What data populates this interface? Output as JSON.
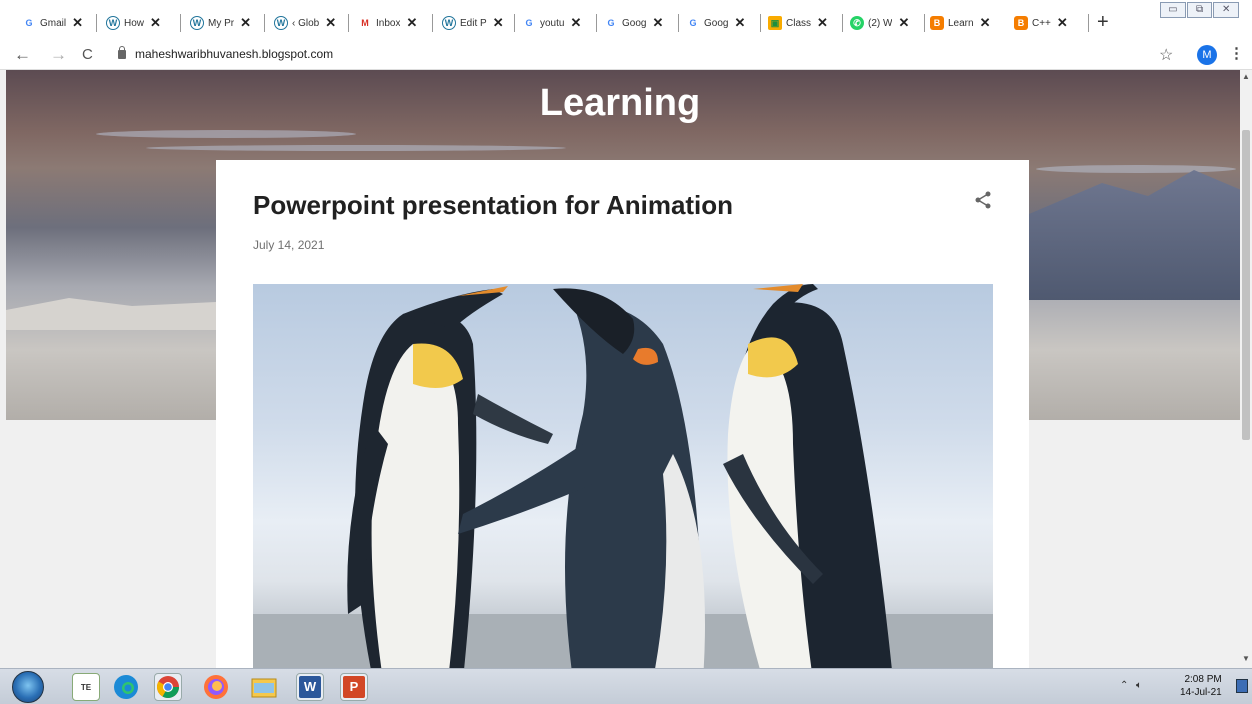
{
  "tabs": [
    {
      "title": "Gmail",
      "icon": "google-icon"
    },
    {
      "title": "How",
      "icon": "wordpress-icon"
    },
    {
      "title": "My Pr",
      "icon": "wordpress-icon"
    },
    {
      "title": "‹ Glob",
      "icon": "wordpress-icon"
    },
    {
      "title": "Inbox",
      "icon": "gmail-icon"
    },
    {
      "title": "Edit P",
      "icon": "wordpress-icon"
    },
    {
      "title": "youtu",
      "icon": "google-icon"
    },
    {
      "title": "Goog",
      "icon": "google-icon"
    },
    {
      "title": "Goog",
      "icon": "google-icon"
    },
    {
      "title": "Class",
      "icon": "classroom-icon"
    },
    {
      "title": "(2) W",
      "icon": "whatsapp-icon"
    },
    {
      "title": "Learn",
      "icon": "blogger-icon"
    },
    {
      "title": "C++",
      "icon": "blogger-icon"
    }
  ],
  "address_bar": {
    "url": "maheshwaribhuvanesh.blogspot.com",
    "profile_initial": "M"
  },
  "blog": {
    "title": "Learning"
  },
  "post": {
    "title": "Powerpoint presentation for Animation",
    "date": "July 14, 2021"
  },
  "taskbar": {
    "time": "2:08 PM",
    "date": "14-Jul-21",
    "apps": [
      "tally-icon",
      "edge-icon",
      "chrome-icon",
      "firefox-icon",
      "file-explorer-icon",
      "word-icon",
      "powerpoint-icon"
    ]
  },
  "colors": {
    "accent_blue": "#1a73e8",
    "blogger_orange": "#f57d00",
    "title_text": "#212121"
  }
}
